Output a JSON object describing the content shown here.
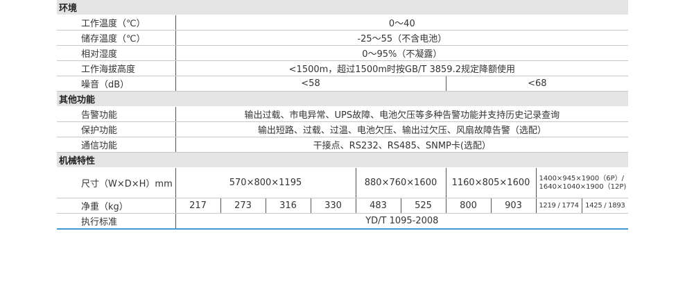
{
  "sections": {
    "env": "环境",
    "other": "其他功能",
    "mech": "机械特性"
  },
  "rows": {
    "work_temp": {
      "label": "工作温度（℃）",
      "value": "0～40"
    },
    "store_temp": {
      "label": "储存温度（℃）",
      "value": "-25～55（不含电池）"
    },
    "humidity": {
      "label": "相对湿度",
      "value": "0～95%（不凝露）"
    },
    "altitude": {
      "label": "工作海拔高度",
      "value": "<1500m，超过1500m时按GB/T 3859.2规定降额使用"
    },
    "noise": {
      "label": "噪音（dB）",
      "values": [
        "<58",
        "<68"
      ]
    },
    "alarm": {
      "label": "告警功能",
      "value": "输出过载、市电异常、UPS故障、电池欠压等多种告警功能并支持历史记录查询"
    },
    "protect": {
      "label": "保护功能",
      "value": "输出短路、过载、过温、电池欠压、输出过欠压、风扇故障告警（选配）"
    },
    "comm": {
      "label": "通信功能",
      "value": "干接点、RS232、RS485、SNMP卡(选配）"
    },
    "size": {
      "label": "尺寸（W×D×H）mm",
      "values": [
        "570×800×1195",
        "880×760×1600",
        "1160×805×1600",
        "1400×945×1900（6P）/ 1640×1040×1900（12P)"
      ]
    },
    "weight": {
      "label": "净重（kg）",
      "values": [
        "217",
        "273",
        "316",
        "330",
        "483",
        "525",
        "800",
        "903",
        "1219 / 1774",
        "1425 / 1893"
      ]
    },
    "standard": {
      "label": "执行标准",
      "value": "YD/T 1095-2008"
    }
  }
}
